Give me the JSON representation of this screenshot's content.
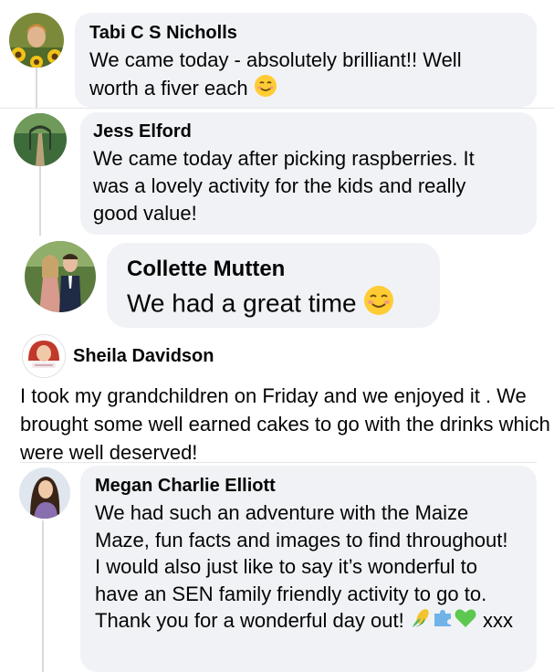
{
  "comments": [
    {
      "author": "Tabi C S Nicholls",
      "text": "We came today - absolutely brilliant!! Well worth a fiver each",
      "emoji": "smiling-face-icon"
    },
    {
      "author": "Jess Elford",
      "text": "We came today after picking raspberries. It was a lovely activity for the kids and really good value!"
    },
    {
      "author": "Collette Mutten",
      "text": "We had a great time",
      "emoji": "blushing-face-icon"
    },
    {
      "author": "Sheila Davidson",
      "text": "I took my grandchildren on Friday and we enjoyed it . We brought some well earned cakes to go with the drinks which were well deserved!"
    },
    {
      "author": "Megan Charlie Elliott",
      "text": "We had such an adventure with the Maize Maze, fun facts and images to find throughout! I would also just like to say it’s wonderful to have an SEN family friendly activity to go to. Thank you for a wonderful day out!",
      "emojis": [
        "corn-icon",
        "puzzle-piece-icon",
        "green-heart-icon"
      ],
      "suffix": "xxx"
    }
  ],
  "colors": {
    "bubble": "#f0f2f5",
    "text": "#050505",
    "thread_line": "#d7dadf",
    "emoji_face": "#ffcc33",
    "heart": "#5cc84f",
    "puzzle": "#6fb3e8",
    "corn": "#f4c430"
  }
}
